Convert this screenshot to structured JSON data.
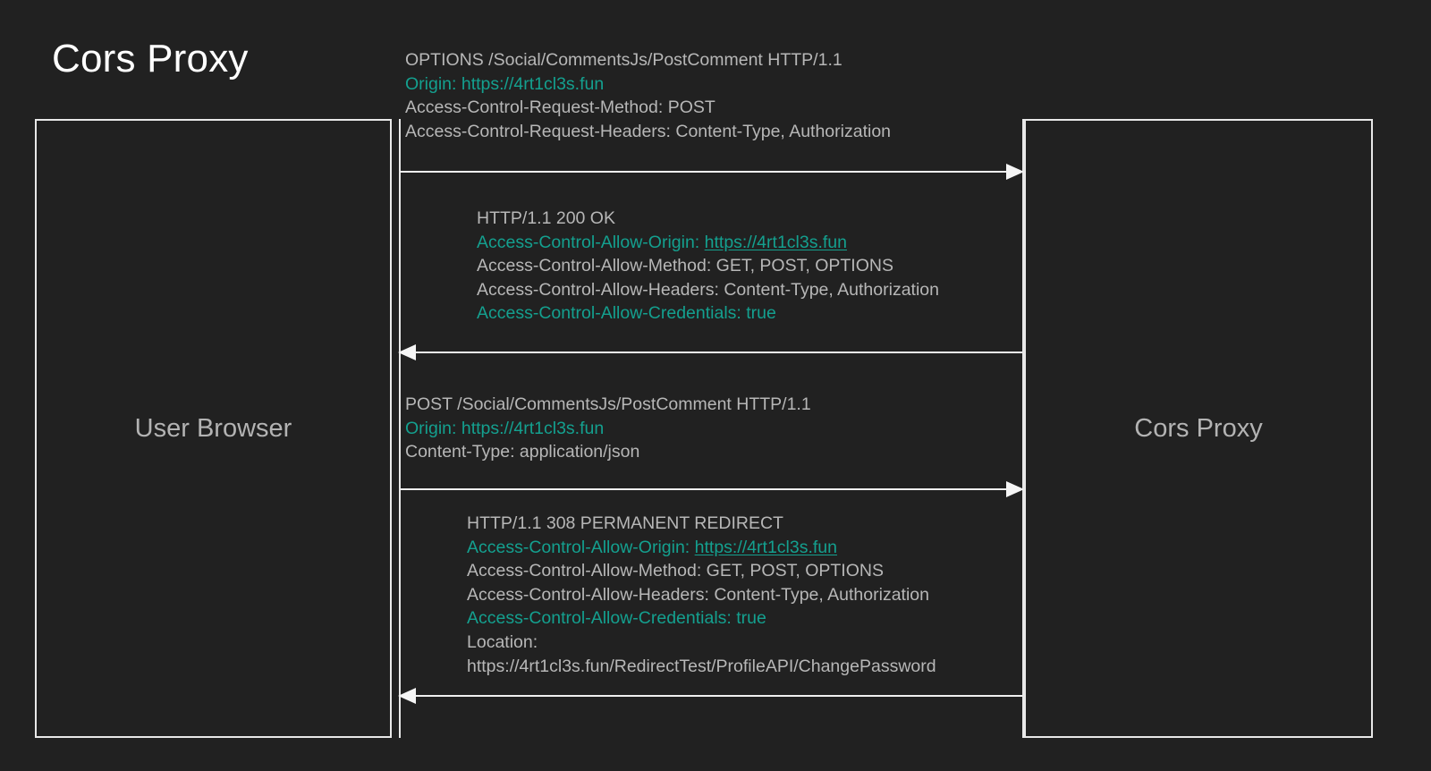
{
  "title": "Cors Proxy",
  "colors": {
    "background": "#212121",
    "line": "#e8e8e8",
    "text": "#b7b7b7",
    "accent_teal": "#14a08f",
    "title": "#ffffff"
  },
  "actors": {
    "left": {
      "name": "User Browser"
    },
    "right": {
      "name": "Cors Proxy"
    }
  },
  "messages": [
    {
      "id": "preflight-request",
      "direction": "left-to-right",
      "lines": [
        {
          "text": "OPTIONS /Social/CommentsJs/PostComment HTTP/1.1",
          "style": "plain"
        },
        {
          "text": "Origin: https://4rt1cl3s.fun",
          "style": "teal"
        },
        {
          "text": "Access-Control-Request-Method: POST",
          "style": "plain"
        },
        {
          "text": "Access-Control-Request-Headers: Content-Type, Authorization",
          "style": "plain"
        }
      ]
    },
    {
      "id": "preflight-response",
      "direction": "right-to-left",
      "lines": [
        {
          "text": "HTTP/1.1 200 OK",
          "style": "plain"
        },
        {
          "text": "Access-Control-Allow-Origin: ",
          "link": "https://4rt1cl3s.fun",
          "style": "teal-link"
        },
        {
          "text": "Access-Control-Allow-Method: GET, POST, OPTIONS",
          "style": "plain"
        },
        {
          "text": "Access-Control-Allow-Headers: Content-Type, Authorization",
          "style": "plain"
        },
        {
          "text": "Access-Control-Allow-Credentials: true",
          "style": "teal"
        }
      ]
    },
    {
      "id": "post-request",
      "direction": "left-to-right",
      "lines": [
        {
          "text": "POST /Social/CommentsJs/PostComment HTTP/1.1",
          "style": "plain"
        },
        {
          "text": "Origin: https://4rt1cl3s.fun",
          "style": "teal"
        },
        {
          "text": "Content-Type: application/json",
          "style": "plain"
        }
      ]
    },
    {
      "id": "redirect-response",
      "direction": "right-to-left",
      "lines": [
        {
          "text": "HTTP/1.1 308 PERMANENT REDIRECT",
          "style": "plain"
        },
        {
          "text": "Access-Control-Allow-Origin: ",
          "link": "https://4rt1cl3s.fun",
          "style": "teal-link"
        },
        {
          "text": "Access-Control-Allow-Method: GET, POST, OPTIONS",
          "style": "plain"
        },
        {
          "text": "Access-Control-Allow-Headers: Content-Type, Authorization",
          "style": "plain"
        },
        {
          "text": "Access-Control-Allow-Credentials: true",
          "style": "teal"
        },
        {
          "text": "Location:",
          "style": "plain"
        },
        {
          "text": "https://4rt1cl3s.fun/RedirectTest/ProfileAPI/ChangePassword",
          "style": "plain"
        }
      ]
    }
  ]
}
